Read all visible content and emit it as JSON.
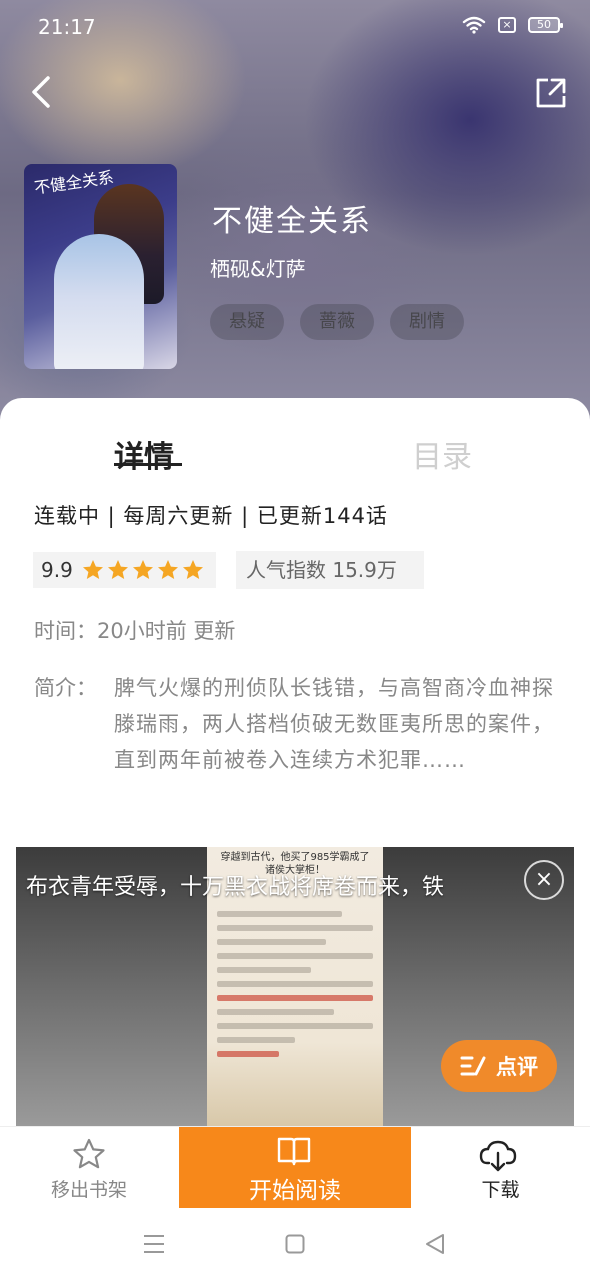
{
  "status_bar": {
    "time": "21:17",
    "sim_label": "×",
    "battery_level": "50"
  },
  "book": {
    "cover_title": "不健全关系",
    "title": "不健全关系",
    "author": "栖砚&灯萨",
    "tags": [
      "悬疑",
      "蔷薇",
      "剧情"
    ]
  },
  "tabs": {
    "detail": "详情",
    "catalog": "目录"
  },
  "info": {
    "update_status": "连载中 | 每周六更新 | 已更新144话",
    "rating": "9.9",
    "stars": 5,
    "popularity": "人气指数 15.9万",
    "time_line": "时间：20小时前 更新",
    "intro_label": "简介：",
    "intro_text": "脾气火爆的刑侦队长钱错，与高智商冷血神探滕瑞雨，两人搭档侦破无数匪夷所思的案件，直到两年前被卷入连续方术犯罪……"
  },
  "ad": {
    "caption": "布衣青年受辱，十万黑衣战将席卷而来，铁",
    "page_header": "穿越到古代，他买了985学霸成了诸侯大掌柜！",
    "close_label": "×",
    "review_label": "点评"
  },
  "bottom_bar": {
    "shelf_label": "移出书架",
    "read_label": "开始阅读",
    "download_label": "下载"
  },
  "colors": {
    "accent": "#f7881a",
    "review_button": "#f08a2a",
    "star": "#f5a623"
  }
}
